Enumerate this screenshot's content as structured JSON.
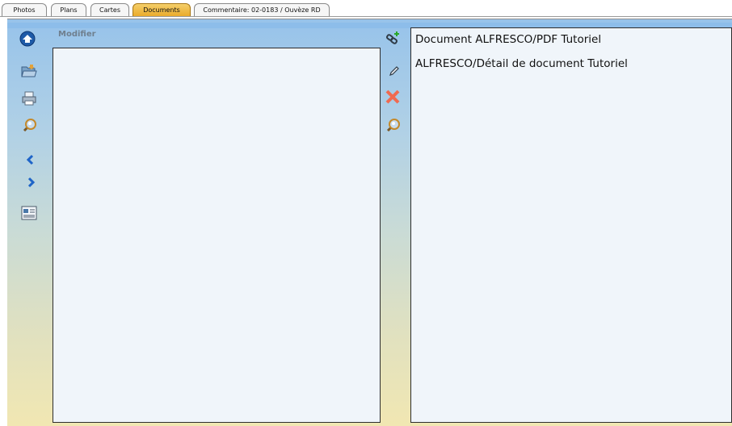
{
  "tabs": [
    {
      "label": "Photos",
      "active": false
    },
    {
      "label": "Plans",
      "active": false
    },
    {
      "label": "Cartes",
      "active": false
    },
    {
      "label": "Documents",
      "active": true
    },
    {
      "label": "Commentaire: 02-0183 / Ouvèze RD",
      "active": false
    }
  ],
  "left_panel": {
    "header": "Modifier"
  },
  "left_toolbar": {
    "icons": [
      "home-up-icon",
      "open-folder-icon",
      "print-icon",
      "search-icon",
      "previous-icon",
      "next-icon",
      "document-view-icon"
    ]
  },
  "right_toolbar": {
    "icons": [
      "add-link-icon",
      "edit-pencil-icon",
      "delete-icon",
      "search-icon"
    ]
  },
  "documents": [
    {
      "label": "Document ALFRESCO/PDF Tutoriel"
    },
    {
      "label": "ALFRESCO/Détail de document Tutoriel"
    }
  ],
  "colors": {
    "active_tab": "#e9a827",
    "panel_bg": "#f0f5fa",
    "gradient_top": "#97c3ea",
    "gradient_bottom": "#f1e7b2",
    "delete_red": "#f06a50",
    "nav_blue": "#1e64c8"
  }
}
